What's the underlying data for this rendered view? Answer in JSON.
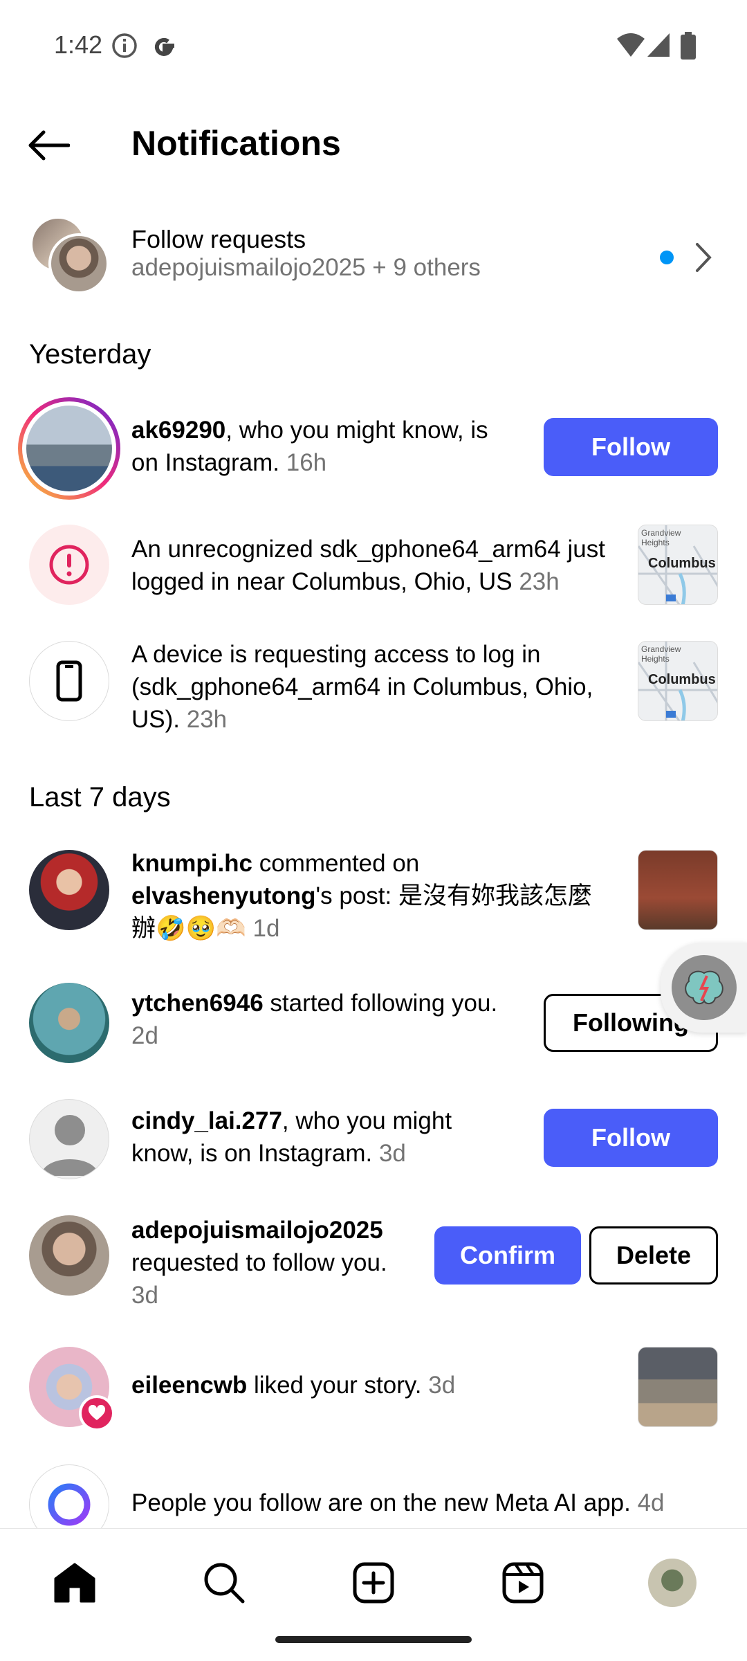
{
  "status_bar": {
    "time": "1:42"
  },
  "header": {
    "title": "Notifications"
  },
  "follow_requests": {
    "title": "Follow requests",
    "subtitle": "adepojuismailojo2025 + 9 others"
  },
  "sections": {
    "yesterday": "Yesterday",
    "last7": "Last 7 days"
  },
  "notifications": {
    "ak": {
      "user": "ak69290",
      "text": ", who you might know, is on Instagram.",
      "time": "16h",
      "button": "Follow"
    },
    "login": {
      "text": "An unrecognized sdk_gphone64_arm64 just logged in near Columbus, Ohio, US",
      "time": "23h",
      "map_label": "Columbus",
      "map_small": "Grandview Heights"
    },
    "device": {
      "text": "A device is requesting access to log in (sdk_gphone64_arm64 in Columbus, Ohio, US).",
      "time": "23h",
      "map_label": "Columbus",
      "map_small": "Grandview Heights"
    },
    "knumpi": {
      "user": "knumpi.hc",
      "text1": " commented on",
      "user2": "elvashenyutong",
      "text2": "'s post: 是沒有妳我該怎麼辦🤣🥹🫶🏻",
      "time": "1d"
    },
    "ytchen": {
      "user": "ytchen6946",
      "text": " started following you.",
      "time": "2d",
      "button": "Following"
    },
    "cindy": {
      "user": "cindy_lai.277",
      "text": ", who you might know, is on Instagram.",
      "time": "3d",
      "button": "Follow"
    },
    "adepoju": {
      "user": "adepojuismailojo2025",
      "text": "requested to follow you.",
      "time": "3d",
      "confirm": "Confirm",
      "delete": "Delete"
    },
    "eileen": {
      "user": "eileencwb",
      "text": " liked your story.",
      "time": "3d"
    },
    "meta": {
      "text": "People you follow are on the new Meta AI app.",
      "time": "4d"
    }
  },
  "colors": {
    "accent": "#4a5df9",
    "muted": "#737373",
    "unread_dot": "#0095f6",
    "alert": "#e0245e"
  },
  "icons": [
    "back-arrow-icon",
    "chevron-right-icon",
    "alert-icon",
    "phone-icon",
    "heart-icon",
    "home-icon",
    "search-icon",
    "create-icon",
    "reels-icon"
  ]
}
